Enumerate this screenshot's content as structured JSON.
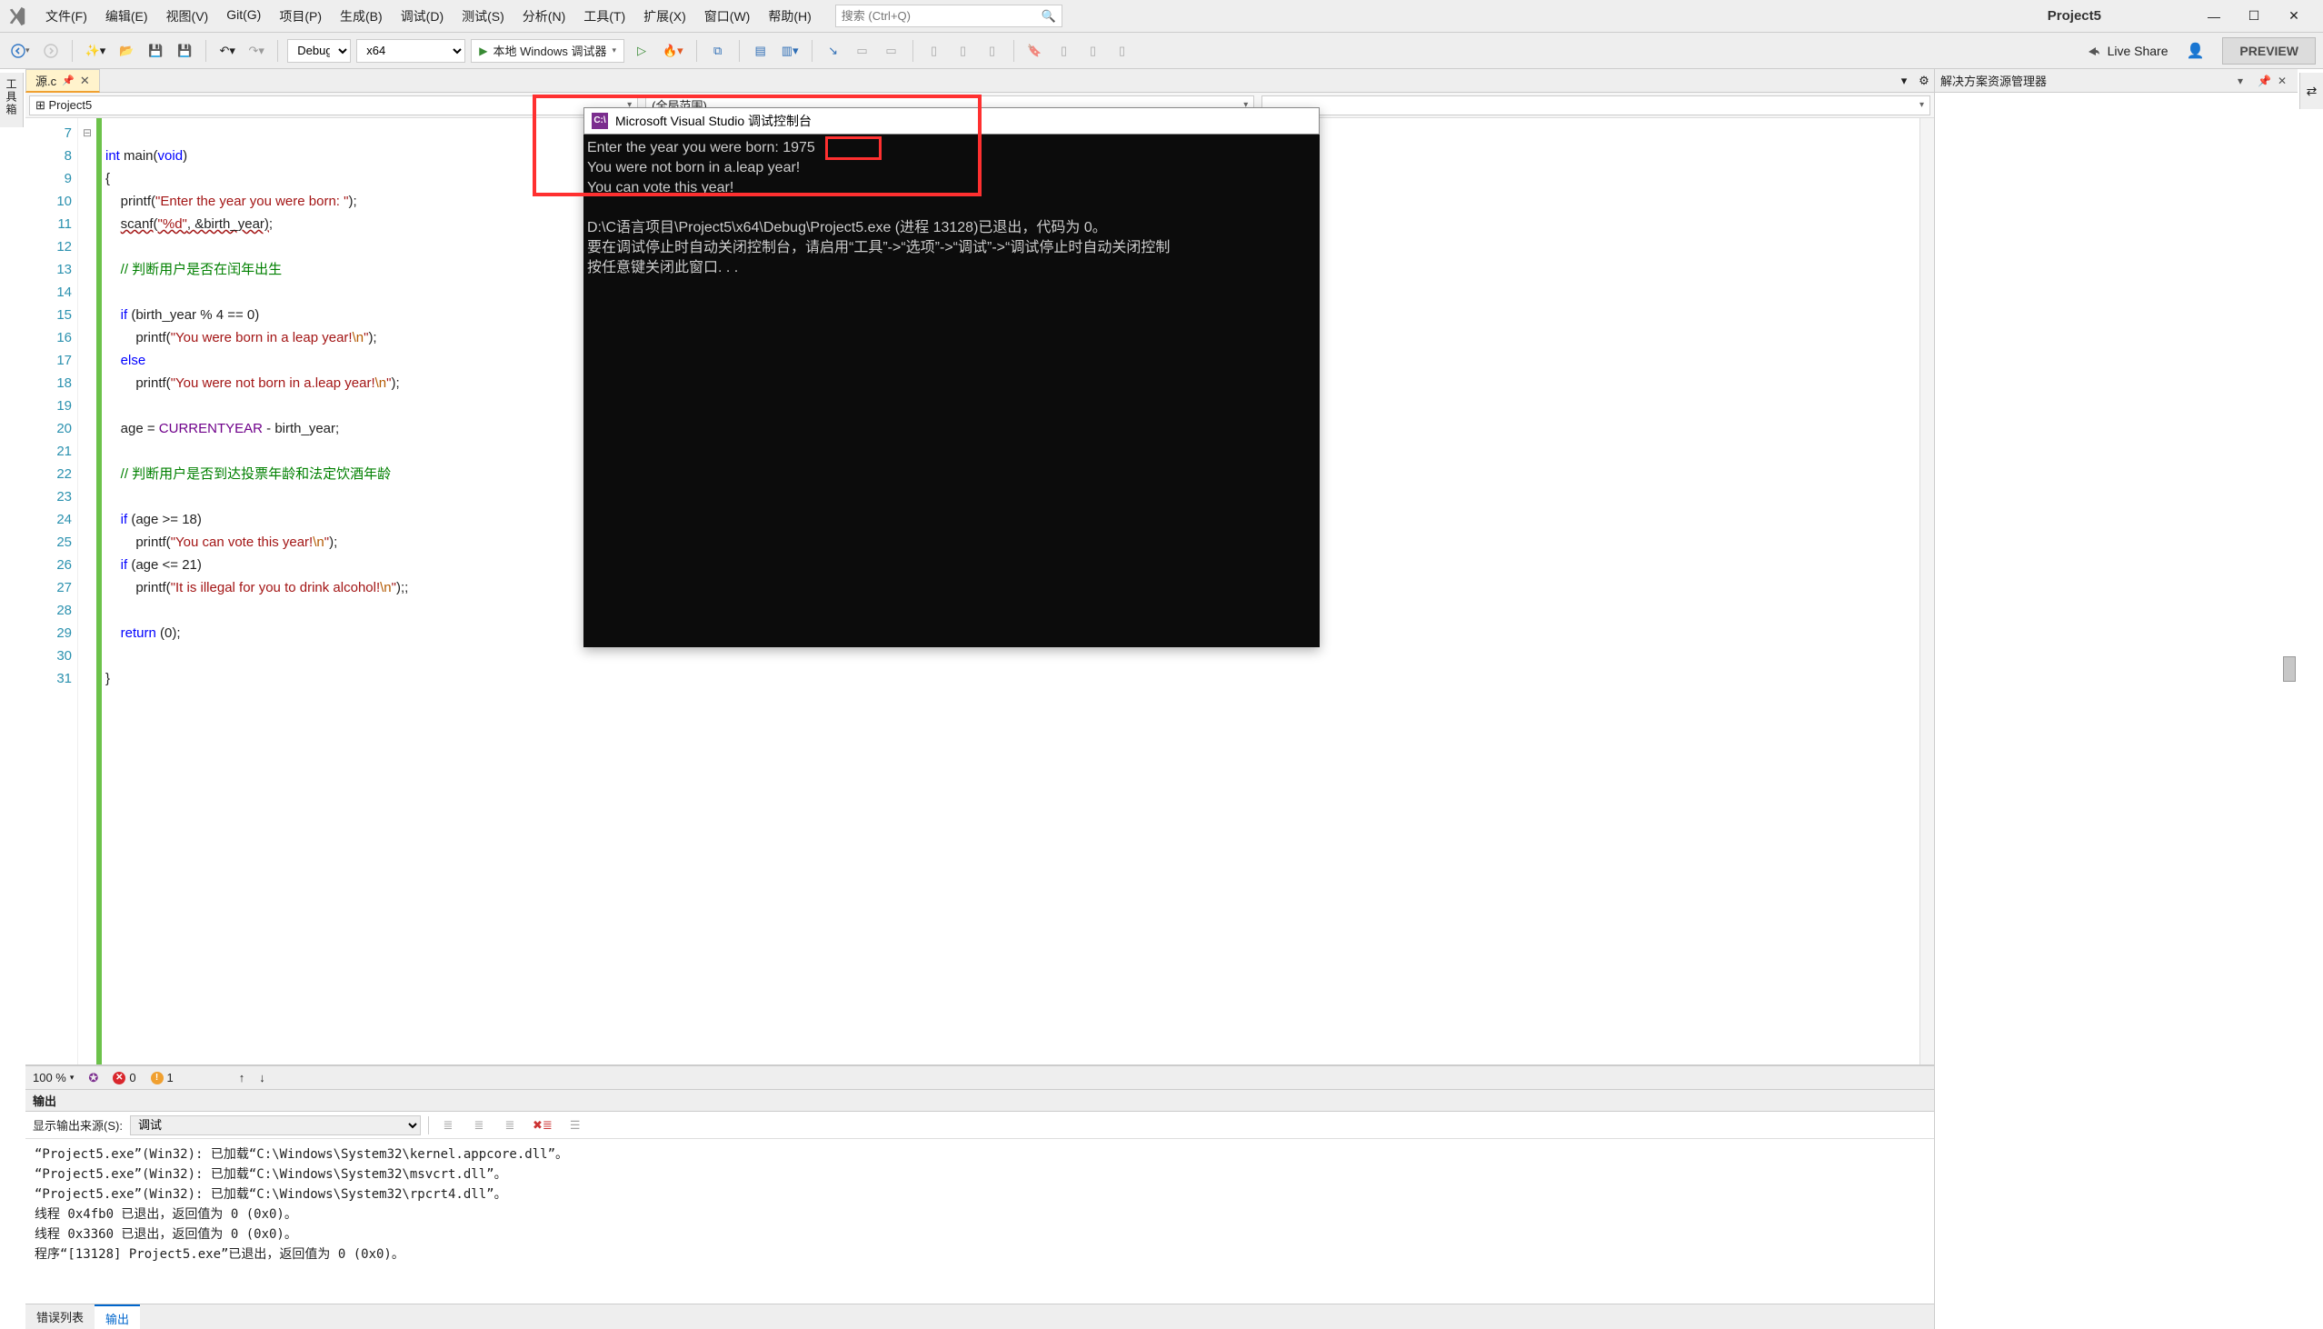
{
  "menu": {
    "items": [
      "文件(F)",
      "编辑(E)",
      "视图(V)",
      "Git(G)",
      "项目(P)",
      "生成(B)",
      "调试(D)",
      "测试(S)",
      "分析(N)",
      "工具(T)",
      "扩展(X)",
      "窗口(W)",
      "帮助(H)"
    ]
  },
  "search": {
    "placeholder": "搜索 (Ctrl+Q)"
  },
  "project_name": "Project5",
  "window": {
    "min": "—",
    "max": "☐",
    "close": "✕"
  },
  "toolbar": {
    "config": "Debug",
    "platform": "x64",
    "run_label": "本地 Windows 调试器",
    "live_share": "Live Share",
    "preview": "PREVIEW"
  },
  "side_left": "工具箱",
  "side_right": "⇄",
  "doc_tab": {
    "name": "源.c",
    "pin": "📌",
    "close": "✕"
  },
  "nav": {
    "scope_project": "Project5",
    "scope_global": "(全局范围)"
  },
  "code": {
    "lines": [
      {
        "n": 7,
        "html": ""
      },
      {
        "n": 8,
        "html": "<span class='k-blue'>int</span> main(<span class='k-blue'>void</span>)"
      },
      {
        "n": 9,
        "html": "{"
      },
      {
        "n": 10,
        "html": "    printf(<span class='k-str'>\"Enter the year you were born: \"</span>);"
      },
      {
        "n": 11,
        "html": "    <span class='k-wavy'>scanf</span>(<span class='k-str k-wavy'>\"%d\"</span><span class='k-wavy'>, &birth_year)</span>;"
      },
      {
        "n": 12,
        "html": ""
      },
      {
        "n": 13,
        "html": "    <span class='k-comm'>// 判断用户是否在闰年出生</span>"
      },
      {
        "n": 14,
        "html": ""
      },
      {
        "n": 15,
        "html": "    <span class='k-blue'>if</span> (birth_year % 4 == 0)"
      },
      {
        "n": 16,
        "html": "        printf(<span class='k-str'>\"You were born in a leap year!</span><span class='k-esc'>\\n</span><span class='k-str'>\"</span>);"
      },
      {
        "n": 17,
        "html": "    <span class='k-blue'>else</span>"
      },
      {
        "n": 18,
        "html": "        printf(<span class='k-str'>\"You were not born in a.leap year!</span><span class='k-esc'>\\n</span><span class='k-str'>\"</span>);"
      },
      {
        "n": 19,
        "html": ""
      },
      {
        "n": 20,
        "html": "    age = <span class='k-macro'>CURRENTYEAR</span> - birth_year;"
      },
      {
        "n": 21,
        "html": ""
      },
      {
        "n": 22,
        "html": "    <span class='k-comm'>// 判断用户是否到达投票年龄和法定饮酒年龄</span>"
      },
      {
        "n": 23,
        "html": ""
      },
      {
        "n": 24,
        "html": "    <span class='k-blue'>if</span> (age &gt;= 18)"
      },
      {
        "n": 25,
        "html": "        printf(<span class='k-str'>\"You can vote this year!</span><span class='k-esc'>\\n</span><span class='k-str'>\"</span>);"
      },
      {
        "n": 26,
        "html": "    <span class='k-blue'>if</span> (age &lt;= 21)"
      },
      {
        "n": 27,
        "html": "        printf(<span class='k-str'>\"It is illegal for you to drink alcohol!</span><span class='k-esc'>\\n</span><span class='k-str'>\"</span>);;"
      },
      {
        "n": 28,
        "html": ""
      },
      {
        "n": 29,
        "html": "    <span class='k-blue'>return</span> (0);"
      },
      {
        "n": 30,
        "html": ""
      },
      {
        "n": 31,
        "html": "}"
      }
    ]
  },
  "status": {
    "zoom": "100 %",
    "errors": "0",
    "warnings": "1",
    "up": "↑",
    "down": "↓"
  },
  "output": {
    "title": "输出",
    "source_label": "显示输出来源(S):",
    "source_value": "调试",
    "lines": [
      "“Project5.exe”(Win32): 已加载“C:\\Windows\\System32\\kernel.appcore.dll”。",
      "“Project5.exe”(Win32): 已加载“C:\\Windows\\System32\\msvcrt.dll”。",
      "“Project5.exe”(Win32): 已加载“C:\\Windows\\System32\\rpcrt4.dll”。",
      "线程 0x4fb0 已退出，返回值为 0 (0x0)。",
      "线程 0x3360 已退出，返回值为 0 (0x0)。",
      "程序“[13128] Project5.exe”已退出，返回值为 0 (0x0)。"
    ]
  },
  "bottom_tabs": {
    "errlist": "错误列表",
    "output": "输出"
  },
  "solution": {
    "title": "解决方案资源管理器"
  },
  "console": {
    "title": "Microsoft Visual Studio 调试控制台",
    "lines": [
      "Enter the year you were born: 1975",
      "You were not born in a.leap year!",
      "You can vote this year!",
      "",
      "D:\\C语言项目\\Project5\\x64\\Debug\\Project5.exe (进程 13128)已退出，代码为 0。",
      "要在调试停止时自动关闭控制台，请启用“工具”->“选项”->“调试”->“调试停止时自动关闭控制",
      "按任意键关闭此窗口. . ."
    ]
  }
}
